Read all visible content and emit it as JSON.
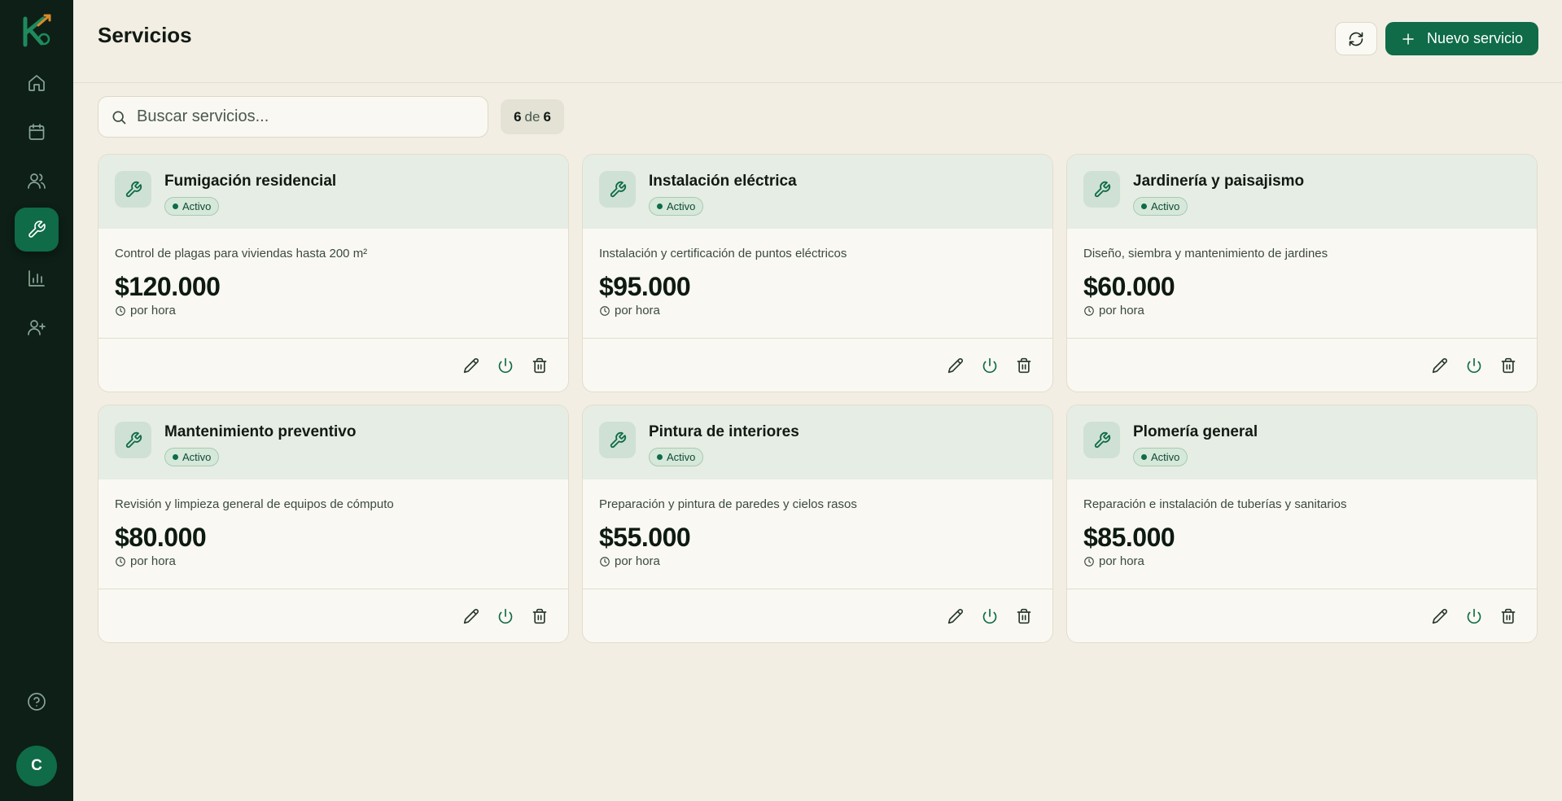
{
  "header": {
    "title": "Servicios",
    "new_label": "Nuevo servicio"
  },
  "search": {
    "placeholder": "Buscar servicios..."
  },
  "count": {
    "shown": "6",
    "sep": "de",
    "total": "6"
  },
  "user": {
    "initial": "C"
  },
  "sidebar": {
    "items": [
      {
        "icon": "home-icon"
      },
      {
        "icon": "calendar-icon"
      },
      {
        "icon": "users-icon"
      },
      {
        "icon": "wrench-icon",
        "active": true
      },
      {
        "icon": "bar-chart-icon"
      },
      {
        "icon": "user-plus-icon"
      }
    ],
    "help_icon": "help-circle-icon"
  },
  "colors": {
    "accent": "#0f6b48",
    "sidebar": "#0d1f17",
    "background": "#f2eee3"
  },
  "services": [
    {
      "name": "Fumigación residencial",
      "status": "Activo",
      "description": "Control de plagas para viviendas hasta 200 m²",
      "price": "$120.000",
      "unit": "por hora"
    },
    {
      "name": "Instalación eléctrica",
      "status": "Activo",
      "description": "Instalación y certificación de puntos eléctricos",
      "price": "$95.000",
      "unit": "por hora"
    },
    {
      "name": "Jardinería y paisajismo",
      "status": "Activo",
      "description": "Diseño, siembra y mantenimiento de jardines",
      "price": "$60.000",
      "unit": "por hora"
    },
    {
      "name": "Mantenimiento preventivo",
      "status": "Activo",
      "description": "Revisión y limpieza general de equipos de cómputo",
      "price": "$80.000",
      "unit": "por hora"
    },
    {
      "name": "Pintura de interiores",
      "status": "Activo",
      "description": "Preparación y pintura de paredes y cielos rasos",
      "price": "$55.000",
      "unit": "por hora"
    },
    {
      "name": "Plomería general",
      "status": "Activo",
      "description": "Reparación e instalación de tuberías y sanitarios",
      "price": "$85.000",
      "unit": "por hora"
    }
  ]
}
